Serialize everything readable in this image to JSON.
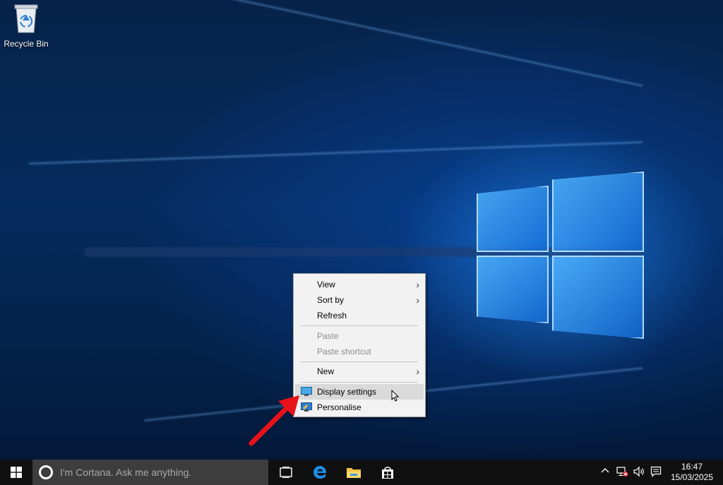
{
  "desktop": {
    "icons": [
      {
        "label": "Recycle Bin",
        "icon": "recycle-bin-icon"
      }
    ]
  },
  "context_menu": {
    "items": [
      {
        "label": "View",
        "has_submenu": true,
        "enabled": true
      },
      {
        "label": "Sort by",
        "has_submenu": true,
        "enabled": true
      },
      {
        "label": "Refresh",
        "has_submenu": false,
        "enabled": true
      },
      {
        "label": "Paste",
        "has_submenu": false,
        "enabled": false
      },
      {
        "label": "Paste shortcut",
        "has_submenu": false,
        "enabled": false
      },
      {
        "label": "New",
        "has_submenu": true,
        "enabled": true
      },
      {
        "label": "Display settings",
        "has_submenu": false,
        "enabled": true,
        "icon": "display-icon",
        "highlighted": true
      },
      {
        "label": "Personalise",
        "has_submenu": false,
        "enabled": true,
        "icon": "personalise-icon"
      }
    ],
    "submenu_glyph": "›"
  },
  "taskbar": {
    "search_placeholder": "I'm Cortana. Ask me anything.",
    "pinned": [
      "task-view-icon",
      "edge-icon",
      "file-explorer-icon",
      "store-icon"
    ],
    "tray": {
      "icons": [
        "chevron-up-icon",
        "network-disconnected-icon",
        "volume-icon",
        "action-center-icon"
      ],
      "time": "16:47",
      "date": "15/03/2025"
    }
  },
  "colors": {
    "taskbar": "#101010",
    "search_box": "#3d3d3d",
    "menu_bg": "#f2f2f2",
    "menu_highlight": "#dadada",
    "annotation_arrow": "#e8111a",
    "windows_blue": "#0078d7"
  }
}
